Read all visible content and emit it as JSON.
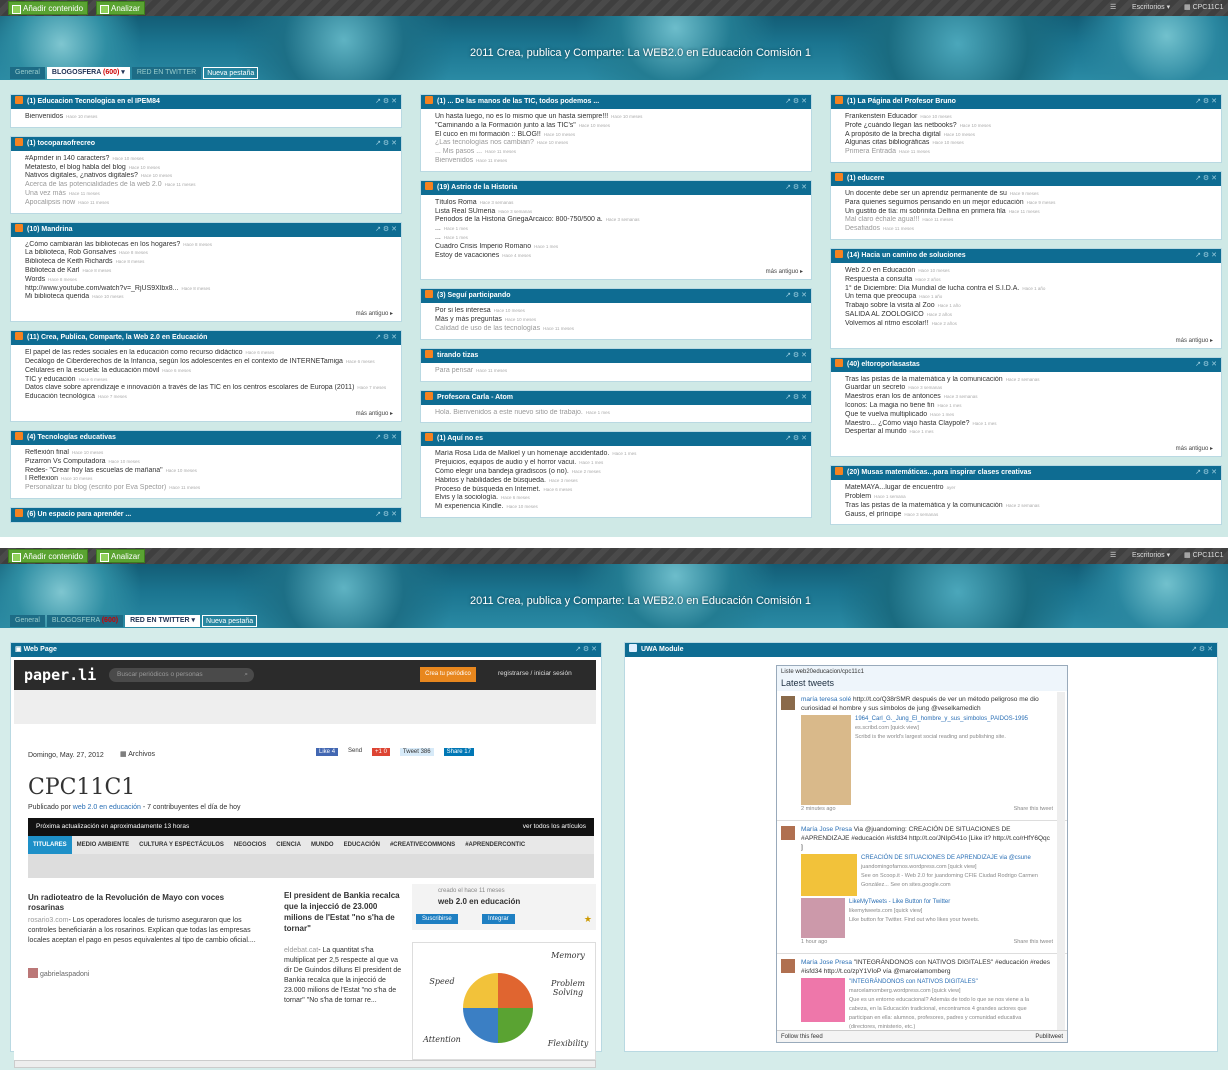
{
  "toolbar": {
    "add": "Añadir contenido",
    "analyze": "Analizar",
    "menu": "Escritorios ▾",
    "user": "CPC11C1"
  },
  "header": {
    "title": "2011 Crea, publica y Comparte: La WEB2.0 en Educación Comisión 1"
  },
  "tabs1": {
    "general": "General",
    "blogosfera": "BLOGOSFERA",
    "count": "(600)",
    "red": "RED EN TWITTER",
    "new": "Nueva pestaña"
  },
  "tabs2": {
    "general": "General",
    "blogosfera": "BLOGOSFERA",
    "count": "(600)",
    "red": "RED EN TWITTER",
    "new": "Nueva pestaña"
  },
  "widgets": [
    {
      "title": "(1) Educacion Tecnologica en el IPEM84",
      "items": [
        "Bienvenidos"
      ],
      "times": [
        "Hace 10 meses"
      ],
      "old": [],
      "more": ""
    },
    {
      "title": "(1) tocoparaofrecreo",
      "items": [
        "#Aprnder in 140 caracters?",
        "Metatesto, el blog habla del blog",
        "Nativos digitales, ¿nativos digitales?",
        "Acerca de las potencialidades de la web 2.0",
        "Una vez más",
        "Apocalipsis now"
      ],
      "times": [
        "Hace 10 meses",
        "Hace 10 meses",
        "Hace 10 meses",
        "Hace 11 meses",
        "Hace 11 meses",
        "Hace 11 meses"
      ],
      "old": [
        3,
        4,
        5
      ],
      "more": ""
    },
    {
      "title": "(10) Mandrina",
      "items": [
        "¿Cómo cambiarán las bibliotecas en los hogares?",
        "La biblioteca, Rob Gonsalves",
        "Biblioteca de Keith Richards",
        "Biblioteca de Karl",
        "Words",
        "http://www.youtube.com/watch?v=_RjUS9Xlbx8...",
        "Mi biblioteca querida"
      ],
      "times": [
        "Hace 8 meses",
        "Hace 8 meses",
        "Hace 8 meses",
        "Hace 8 meses",
        "Hace 8 meses",
        "Hace 8 meses",
        "Hace 10 meses"
      ],
      "old": [],
      "more": "más antiguo"
    },
    {
      "title": "(11) Crea, Publica, Comparte, la Web 2.0 en Educación",
      "items": [
        "El papel de las redes sociales en la educación como recurso didáctico",
        "Decálogo de Ciberderechos de la Infancia, según los adolescentes en el contexto de INTERNETamiga",
        "Celulares en la escuela: la educación móvil",
        "TIC y educación",
        "Datos clave sobre aprendizaje e innovación a través de las TIC en los centros escolares de Europa (2011)",
        "Educación tecnológica"
      ],
      "times": [
        "Hace 6 meses",
        "Hace 6 meses",
        "Hace 6 meses",
        "Hace 6 meses",
        "Hace 7 meses",
        "Hace 7 meses"
      ],
      "old": [],
      "more": "más antiguo"
    },
    {
      "title": "(4) Tecnologías educativas",
      "items": [
        "Reflexión final",
        "Pizarron Vs Computadora",
        "Redes- \"Crear hoy las escuelas de mañana\"",
        "I Reflexion",
        "Personalizar tu blog (escrito por Eva Spector)"
      ],
      "times": [
        "Hace 10 meses",
        "Hace 10 meses",
        "Hace 10 meses",
        "Hace 10 meses",
        "Hace 11 meses"
      ],
      "old": [
        4
      ],
      "more": ""
    },
    {
      "title": "(6) Un espacio para aprender ...",
      "items": [],
      "times": [],
      "old": [],
      "more": ""
    },
    {
      "title": "(1) ... De las manos de las TIC, todos podemos ...",
      "items": [
        "Un hasta luego, no es lo mismo que un hasta siempre!!!",
        "\"Caminando a la Formación junto a las TIC's\"",
        "El cuco en mi formación :: BLOG!!",
        "¿Las tecnologías nos cambian?",
        "... Mis pasos ...",
        "Bienvenidos"
      ],
      "times": [
        "Hace 10 meses",
        "Hace 10 meses",
        "Hace 10 meses",
        "Hace 10 meses",
        "Hace 11 meses",
        "Hace 11 meses"
      ],
      "old": [
        3,
        4,
        5
      ],
      "more": ""
    },
    {
      "title": "(19) Astrio de la Historia",
      "items": [
        "Títulos Roma",
        "Lista Real SUmeria",
        "Periodos de la Historia GriegaArcaico: 800-750/500 a.",
        "...",
        "...",
        "Cuadro Crisis Imperio Romano",
        "Estoy de vacaciones"
      ],
      "times": [
        "Hace 3 semanas",
        "Hace 3 semanas",
        "Hace 3 semanas",
        "Hace 1 mes",
        "Hace 1 mes",
        "Hace 1 mes",
        "Hace 4 meses"
      ],
      "old": [],
      "more": "más antiguo"
    },
    {
      "title": "(3) Seguí participando",
      "items": [
        "Por si les interesa",
        "Más y más preguntas",
        "Calidad de uso de las tecnologías"
      ],
      "times": [
        "Hace 10 meses",
        "Hace 10 meses",
        "Hace 11 meses"
      ],
      "old": [
        2
      ],
      "more": ""
    },
    {
      "title": "tirando tizas",
      "items": [
        "Para pensar"
      ],
      "times": [
        "Hace 11 meses"
      ],
      "old": [
        0
      ],
      "more": ""
    },
    {
      "title": "Profesora Carla - Atom",
      "items": [
        "Hola. Bienvenidos a este nuevo sitio de trabajo."
      ],
      "times": [
        "Hace 1 mes"
      ],
      "old": [
        0
      ],
      "more": ""
    },
    {
      "title": "(1) Aquí no es",
      "items": [
        "María Rosa Lida de Malkiel y un homenaje accidentado.",
        "Prejuicios, equipos de audio y el horror vacui.",
        "Cómo elegir una bandeja giradiscos (o no).",
        "Hábitos y habilidades de búsqueda.",
        "Proceso de búsqueda en Internet.",
        "Elvis y la sociología.",
        "Mi experiencia Kindle."
      ],
      "times": [
        "Hace 1 mes",
        "Hace 1 mes",
        "Hace 2 meses",
        "Hace 3 meses",
        "Hace 6 meses",
        "Hace 6 meses",
        "Hace 10 meses"
      ],
      "old": [],
      "more": ""
    },
    {
      "title": "(1) La Página del Profesor Bruno",
      "items": [
        "Frankenstein Educador",
        "Profe ¿cuándo llegan las netbooks?",
        "A propósito de la brecha digital",
        "Algunas citas bibliográficas",
        "Primera Entrada"
      ],
      "times": [
        "Hace 10 meses",
        "Hace 10 meses",
        "Hace 10 meses",
        "Hace 10 meses",
        "Hace 11 meses"
      ],
      "old": [
        4
      ],
      "more": ""
    },
    {
      "title": "(1) educere",
      "items": [
        "Un docente debe ser un aprendiz permanente de su",
        "Para quienes seguimos pensando en un mejor educación",
        "Un gustito de tía: mi sobrinita Delfina en primera fila",
        "Mal claro échale agua!!!",
        "Desafiados"
      ],
      "times": [
        "Hace 9 meses",
        "Hace 9 meses",
        "Hace 11 meses",
        "Hace 11 meses",
        "Hace 11 meses"
      ],
      "old": [
        3,
        4
      ],
      "more": ""
    },
    {
      "title": "(14) Hacia un camino de soluciones",
      "items": [
        "Web 2.0 en Educación",
        "Respuesta a consulta",
        "1° de Diciembre: Día Mundial de lucha contra el S.I.D.A.",
        "Un tema que preocupa",
        "Trabajo sobre la visita al Zoo",
        "SALIDA AL ZOOLÓGICO",
        "Volvemos al ritmo escolar!!"
      ],
      "times": [
        "Hace 10 meses",
        "Hace 2 años",
        "Hace 1 año",
        "Hace 1 año",
        "Hace 1 año",
        "Hace 2 años",
        "Hace 2 años"
      ],
      "old": [],
      "more": "más antiguo"
    },
    {
      "title": "(40) eltoroporlasastas",
      "items": [
        "Tras las pistas de la matemática y la comunicación",
        "Guardar un secreto",
        "Maestros eran los de antonces",
        "Iconos: La magia no tiene fin",
        "Que te vuelva multiplicado",
        "Maestro... ¿Cómo viajo hasta Claypole?",
        "Despertar al mundo"
      ],
      "times": [
        "Hace 2 semanas",
        "Hace 3 semanas",
        "Hace 3 semanas",
        "Hace 1 mes",
        "Hace 1 mes",
        "Hace 1 mes",
        "Hace 1 mes"
      ],
      "old": [],
      "more": "más antiguo"
    },
    {
      "title": "(20) Musas matemáticas...para inspirar clases creativas",
      "items": [
        "MateMAYA...lugar de encuentro",
        "Problem",
        "Tras las pistas de la matemática y la comunicación",
        "Gauss, el príncipe"
      ],
      "times": [
        "ayer",
        "Hace 1 semana",
        "Hace 2 semanas",
        "Hace 3 semanas"
      ],
      "old": [],
      "more": ""
    }
  ],
  "webpage": {
    "widget_title": "Web Page",
    "logo": "paper.li",
    "search": "Buscar periódicos o personas",
    "create": "Crea tu periódico",
    "register": "registrarse / iniciar sesión",
    "date": "Domingo, May. 27, 2012",
    "archive": "Archivos",
    "like": "Like",
    "like_n": "4",
    "send": "Send",
    "plus": "+1",
    "plus_n": "0",
    "tweet": "Tweet",
    "tweet_n": "386",
    "share": "Share",
    "share_n": "17",
    "heading": "CPC11C1",
    "published": "Publicado por",
    "by": "web 2.0 en educación",
    "contrib": "- 7 contribuyentes el día de hoy",
    "next": "Próxima actualización en aproximadamente 13 horas",
    "all": "ver todos los artículos",
    "nav": [
      "TITULARES",
      "MEDIO AMBIENTE",
      "CULTURA Y ESPECTÁCULOS",
      "NEGOCIOS",
      "CIENCIA",
      "MUNDO",
      "EDUCACIÓN",
      "#CREATIVECOMMONS",
      "#APRENDERCONTIC"
    ],
    "a1_title": "Un radioteatro de la Revolución de Mayo con voces rosarinas",
    "a1_src": "rosario3.com",
    "a1_text": "- Los operadores locales de turismo aseguraron que los controles beneficiarán a los rosarinos. Explican que todas las empresas locales aceptan el pago en pesos equivalentes al tipo de cambio oficial....",
    "a1_user": "gabrielaspadoni",
    "a2_title": "El president de Bankia recalca que la injecció de 23.000 milions de l'Estat \"no s'ha de tornar\"",
    "a2_src": "eldebat.cat",
    "a2_text": "- La quantitat s'ha multiplicat per 2,5 respecte al que va dir De Guindos dilluns El president de Bankia recalca que la injecció de 23.000 milions de l'Estat \"no s'ha de tornar\" \"No s'ha de tornar re...",
    "side_created": "creado el hace 11 meses",
    "side_name": "web 2.0 en educación",
    "subscribe": "Suscribirse",
    "integrate": "Integrar",
    "ad_words": [
      "Memory",
      "Speed",
      "Problem Solving",
      "Attention",
      "Flexibility"
    ]
  },
  "uwa": {
    "widget_title": "UWA Module",
    "list": "Liste web20educacion/cpc11c1",
    "latest": "Latest tweets",
    "t1_user": "maría teresa solé",
    "t1_text": "http://t.co/Q38rSMR después de ver un método peligroso me dio curiosidad el hombre y sus símbolos de jung @veselkamedich",
    "t1_link": "1964_Carl_G._Jung_El_hombre_y_sus_simbolos_PAIDOS-1995",
    "t1_site": "es.scribd.com [quick view]",
    "t1_desc": "Scribd is the world's largest social reading and publishing site.",
    "t1_time": "2 minutes ago",
    "share": "Share this tweet",
    "t2_user": "María Jose Presa",
    "t2_text": "Via @juandoming: CREACIÓN DE SITUACIONES DE #APRENDIZAJE #educación #isfd34 http://t.co/JNIpG41o [Like it? http://t.co/rHfY6Qqc ]",
    "t2_link": "CREACIÓN DE SITUACIONES DE APRENDIZAJE via @csune",
    "t2_site": "juandomingofarnos.wordpress.com [quick view]",
    "t2_desc": "See on Scoop.it - Web 2.0 for juandoming CFIE Ciudad Rodrigo Carmen González... See on sites.google.com",
    "t2_link2": "LikeMyTweets - Like Button for Twitter",
    "t2_site2": "likemytweets.com [quick view]",
    "t2_desc2": "Like button for Twitter. Find out who likes your tweets.",
    "t2_time": "1 hour ago",
    "t3_user": "María Jose Presa",
    "t3_text": "\"INTEGRÁNDONOS con NATIVOS DIGITALES\" #educación #redes #isfd34 http://t.co/zpY1VIoP vía @marcelamomberg",
    "t3_link": "\"INTEGRÁNDONOS con NATIVOS DIGITALES\"",
    "t3_site": "marcelamomberg.wordpress.com [quick view]",
    "t3_desc": "Que es un entorno educacional? Además de todo lo que se nos viene a la cabeza, en la Educación tradicional, encontramos 4 grandes actores que participan en ella: alumnos, profesores, padres y comunidad educativa (directores, ministerio, etc.)",
    "follow": "Follow this feed",
    "pub": "Publitweet"
  }
}
